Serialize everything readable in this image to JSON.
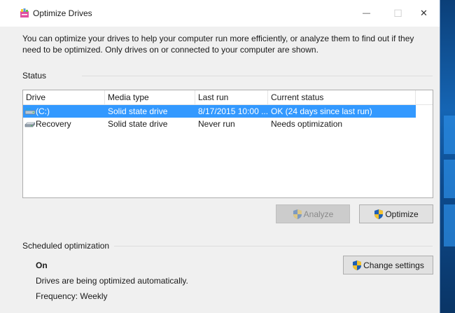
{
  "window": {
    "title": "Optimize Drives",
    "minimize_glyph": "—",
    "maximize_glyph": "☐",
    "close_glyph": "✕"
  },
  "description": "You can optimize your drives to help your computer run more efficiently, or analyze them to find out if they need to be optimized. Only drives on or connected to your computer are shown.",
  "status": {
    "label": "Status",
    "columns": [
      "Drive",
      "Media type",
      "Last run",
      "Current status"
    ],
    "drives": [
      {
        "drive": "(C:)",
        "media_type": "Solid state drive",
        "last_run": "8/17/2015 10:00 ...",
        "current_status": "OK (24 days since last run)",
        "selected": true,
        "icon": "system-drive-icon"
      },
      {
        "drive": "Recovery",
        "media_type": "Solid state drive",
        "last_run": "Never run",
        "current_status": "Needs optimization",
        "selected": false,
        "icon": "drive-icon"
      }
    ]
  },
  "buttons": {
    "analyze": "Analyze",
    "optimize": "Optimize",
    "change_settings": "Change settings"
  },
  "scheduled": {
    "label": "Scheduled optimization",
    "state": "On",
    "description": "Drives are being optimized automatically.",
    "frequency": "Frequency: Weekly"
  },
  "colors": {
    "selection": "#3399ff",
    "window_bg": "#f0f0f0",
    "shield_blue": "#1e5fb5",
    "shield_yellow": "#f2c230"
  }
}
